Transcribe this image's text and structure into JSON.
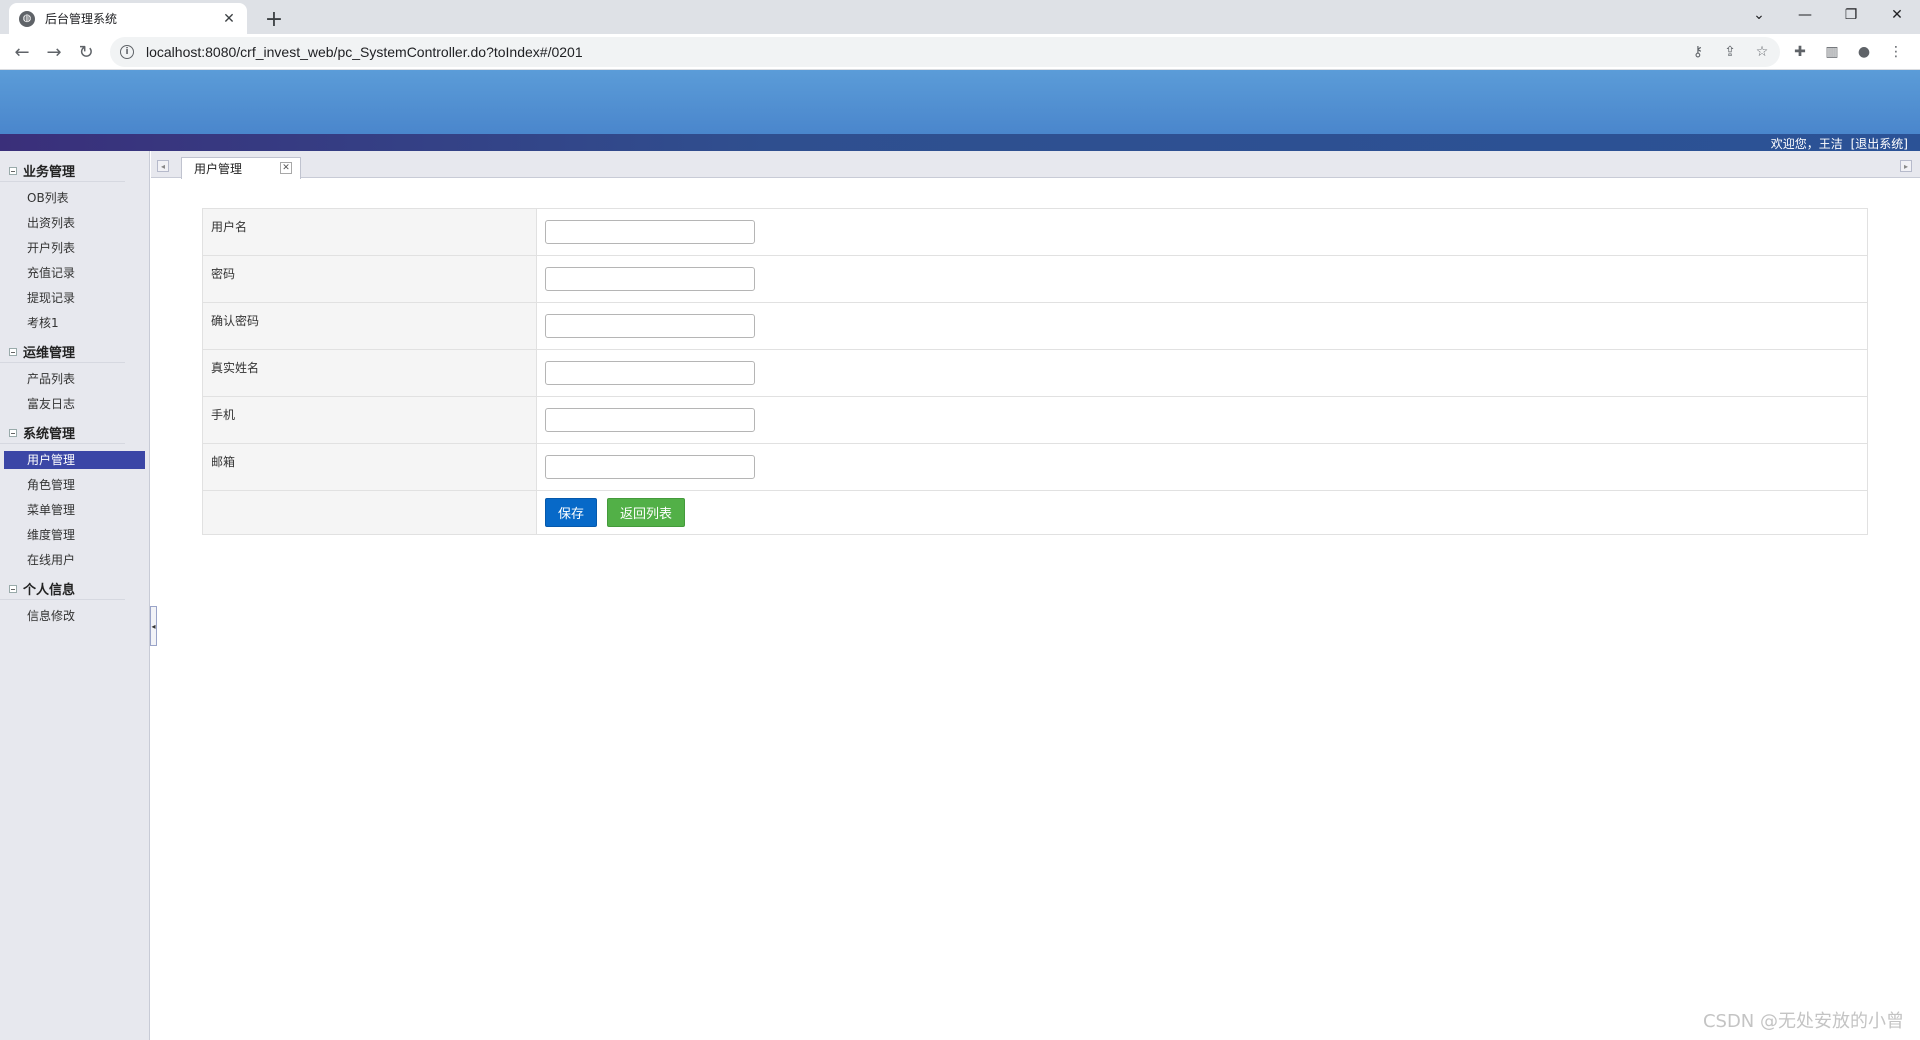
{
  "browser": {
    "tab_title": "后台管理系统",
    "tab_close": "✕",
    "new_tab": "+",
    "url": "localhost:8080/crf_invest_web/pc_SystemController.do?toIndex#/0201",
    "controls": {
      "dropdown": "⌄",
      "minimize": "—",
      "restore": "❐",
      "close": "✕"
    },
    "nav": {
      "back": "←",
      "forward": "→",
      "reload": "↻"
    }
  },
  "header": {
    "welcome": "欢迎您，王洁",
    "logout": "[退出系统]"
  },
  "sidebar": {
    "groups": [
      {
        "title": "业务管理",
        "items": [
          "OB列表",
          "出资列表",
          "开户列表",
          "充值记录",
          "提现记录",
          "考核1"
        ]
      },
      {
        "title": "运维管理",
        "items": [
          "产品列表",
          "富友日志"
        ]
      },
      {
        "title": "系统管理",
        "items": [
          "用户管理",
          "角色管理",
          "菜单管理",
          "维度管理",
          "在线用户"
        ]
      },
      {
        "title": "个人信息",
        "items": [
          "信息修改"
        ]
      }
    ],
    "active_item": "用户管理"
  },
  "content_tab": {
    "label": "用户管理",
    "close": "✕"
  },
  "form": {
    "fields": [
      {
        "label": "用户名",
        "value": ""
      },
      {
        "label": "密码",
        "value": ""
      },
      {
        "label": "确认密码",
        "value": ""
      },
      {
        "label": "真实姓名",
        "value": ""
      },
      {
        "label": "手机",
        "value": ""
      },
      {
        "label": "邮箱",
        "value": ""
      }
    ],
    "save_label": "保存",
    "back_label": "返回列表"
  },
  "watermark": "CSDN @无处安放的小曾",
  "colors": {
    "banner": "#5b9cd8",
    "strip": "#2f4f8f",
    "active_menu": "#3b46a6",
    "save": "#0769c8",
    "back": "#52b047"
  }
}
